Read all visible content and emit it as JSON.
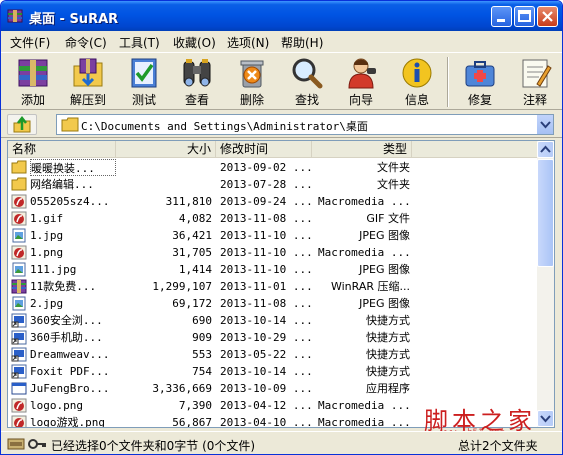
{
  "window": {
    "title": "桌面 - SuRAR"
  },
  "menu": [
    "文件(F)",
    "命令(C)",
    "工具(T)",
    "收藏(O)",
    "选项(N)",
    "帮助(H)"
  ],
  "toolbar": [
    {
      "label": "添加",
      "icon": "rar-books-icon"
    },
    {
      "label": "解压到",
      "icon": "extract-folder-icon"
    },
    {
      "label": "测试",
      "icon": "test-check-icon"
    },
    {
      "label": "查看",
      "icon": "binoculars-icon"
    },
    {
      "label": "删除",
      "icon": "delete-icon"
    },
    {
      "label": "查找",
      "icon": "magnifier-icon"
    },
    {
      "label": "向导",
      "icon": "wizard-person-icon"
    },
    {
      "label": "信息",
      "icon": "info-icon"
    },
    {
      "label": "修复",
      "icon": "repair-kit-icon"
    },
    {
      "label": "注释",
      "icon": "comment-icon"
    }
  ],
  "address": {
    "path": "C:\\Documents and Settings\\Administrator\\桌面"
  },
  "columns": {
    "name": "名称",
    "size": "大小",
    "modified": "修改时间",
    "type": "类型"
  },
  "files": [
    {
      "icon": "folder-icon",
      "name": "暖暖换装...",
      "size": "",
      "date": "2013-09-02 ...",
      "type": "文件夹",
      "mono": false
    },
    {
      "icon": "folder-icon",
      "name": "网络编辑...",
      "size": "",
      "date": "2013-07-28 ...",
      "type": "文件夹",
      "mono": false
    },
    {
      "icon": "flash-icon",
      "name": "055205sz4...",
      "size": "311,810",
      "date": "2013-09-24 ...",
      "type": "Macromedia ...",
      "mono": true
    },
    {
      "icon": "flash-icon",
      "name": "1.gif",
      "size": "4,082",
      "date": "2013-11-08 ...",
      "type": "GIF 文件",
      "mono": false
    },
    {
      "icon": "image-icon",
      "name": "1.jpg",
      "size": "36,421",
      "date": "2013-11-10 ...",
      "type": "JPEG 图像",
      "mono": false
    },
    {
      "icon": "flash-icon",
      "name": "1.png",
      "size": "31,705",
      "date": "2013-11-10 ...",
      "type": "Macromedia ...",
      "mono": true
    },
    {
      "icon": "image-icon",
      "name": "111.jpg",
      "size": "1,414",
      "date": "2013-11-10 ...",
      "type": "JPEG 图像",
      "mono": false
    },
    {
      "icon": "rar-archive-icon",
      "name": "11款免费...",
      "size": "1,299,107",
      "date": "2013-11-01 ...",
      "type": "WinRAR 压缩...",
      "mono": false
    },
    {
      "icon": "image-icon",
      "name": "2.jpg",
      "size": "69,172",
      "date": "2013-11-08 ...",
      "type": "JPEG 图像",
      "mono": false
    },
    {
      "icon": "shortcut-icon",
      "name": "360安全浏...",
      "size": "690",
      "date": "2013-10-14 ...",
      "type": "快捷方式",
      "mono": false
    },
    {
      "icon": "shortcut-icon",
      "name": "360手机助...",
      "size": "909",
      "date": "2013-10-29 ...",
      "type": "快捷方式",
      "mono": false
    },
    {
      "icon": "shortcut-icon",
      "name": "Dreamweav...",
      "size": "553",
      "date": "2013-05-22 ...",
      "type": "快捷方式",
      "mono": false
    },
    {
      "icon": "shortcut-icon",
      "name": "Foxit PDF...",
      "size": "754",
      "date": "2013-10-14 ...",
      "type": "快捷方式",
      "mono": false
    },
    {
      "icon": "app-icon",
      "name": "JuFengBro...",
      "size": "3,336,669",
      "date": "2013-10-09 ...",
      "type": "应用程序",
      "mono": false
    },
    {
      "icon": "flash-icon",
      "name": "logo.png",
      "size": "7,390",
      "date": "2013-04-12 ...",
      "type": "Macromedia ...",
      "mono": true
    },
    {
      "icon": "flash-icon",
      "name": "logo游戏.png",
      "size": "56,867",
      "date": "2013-04-10 ...",
      "type": "Macromedia ...",
      "mono": true
    }
  ],
  "status": {
    "left": "已经选择0个文件夹和0字节 (0个文件)",
    "right": "总计2个文件夹"
  },
  "watermark": {
    "main": "脚本之家",
    "sub": "www.jb51.net"
  },
  "colors": {
    "titlebar": "#0054e3",
    "window_bg": "#ece9d8",
    "close_button": "#c83c1a",
    "watermark": "#cc1f1f"
  }
}
